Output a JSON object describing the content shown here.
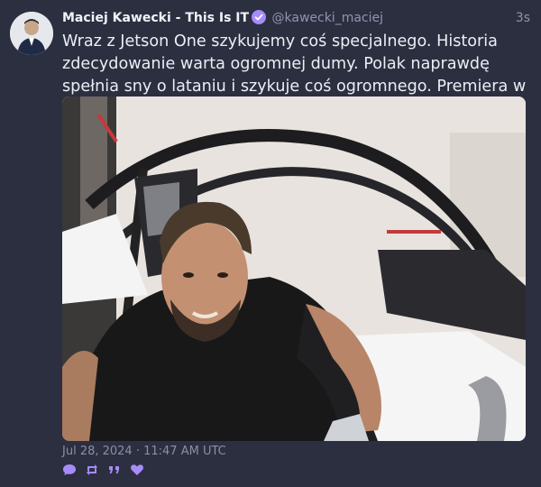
{
  "post": {
    "author": {
      "display_name": "Maciej Kawecki - This Is IT",
      "handle": "@kawecki_maciej",
      "verified_icon": "verified-badge-icon"
    },
    "relative_time": "3s",
    "text": "Wraz z Jetson One szykujemy coś specjalnego. Historia zdecydowanie warta ogromnej dumy. Polak naprawdę spełnia sny o lataniu i szykuje coś ogromnego. Premiera w listopadzie.",
    "media": {
      "description_icon": "photo-icon"
    },
    "timestamp": "Jul 28, 2024 · 11:47 AM UTC",
    "actions": [
      "reply-icon",
      "repost-icon",
      "quote-icon",
      "like-icon"
    ]
  },
  "colors": {
    "background": "#2b2f40",
    "accent": "#a78bfa",
    "muted": "#8f95ae"
  }
}
